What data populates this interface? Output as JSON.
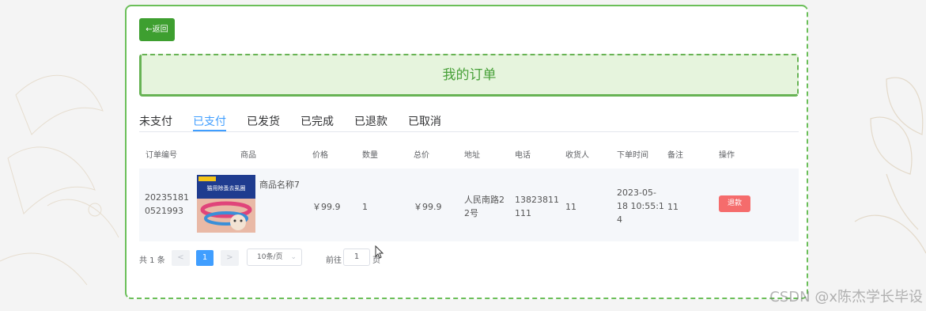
{
  "back_button": {
    "label": "←返回"
  },
  "page_title": "我的订单",
  "tabs": [
    {
      "label": "未支付",
      "active": false
    },
    {
      "label": "已支付",
      "active": true
    },
    {
      "label": "已发货",
      "active": false
    },
    {
      "label": "已完成",
      "active": false
    },
    {
      "label": "已退款",
      "active": false
    },
    {
      "label": "已取消",
      "active": false
    }
  ],
  "table": {
    "headers": [
      "订单编号",
      "商品",
      "价格",
      "数量",
      "总价",
      "地址",
      "电话",
      "收货人",
      "下单时间",
      "备注",
      "操作"
    ],
    "rows": [
      {
        "order_no_line1": "20235181",
        "order_no_line2": "0521993",
        "product_name": "商品名称7",
        "product_image_text": "猫用除蚤去虱圈",
        "price": "￥99.9",
        "quantity": "1",
        "total": "￥99.9",
        "address_line1": "人民南路2",
        "address_line2": "2号",
        "phone_line1": "13823811",
        "phone_line2": "111",
        "receiver": "11",
        "order_time_line1": "2023-05-",
        "order_time_line2": "18 10:55:1",
        "order_time_line3": "4",
        "note": "11",
        "action_label": "退款"
      }
    ]
  },
  "pagination": {
    "total_label": "共 1 条",
    "prev": "<",
    "current_page": "1",
    "next": ">",
    "page_size": "10条/页",
    "goto_label": "前往",
    "goto_value": "1",
    "page_unit": "页"
  },
  "watermark": "CSDN @x陈杰学长毕设",
  "colors": {
    "accent_green": "#3e9f30",
    "title_bg": "#e6f4dd",
    "tab_active": "#409eff",
    "refund_red": "#f56c6c"
  }
}
